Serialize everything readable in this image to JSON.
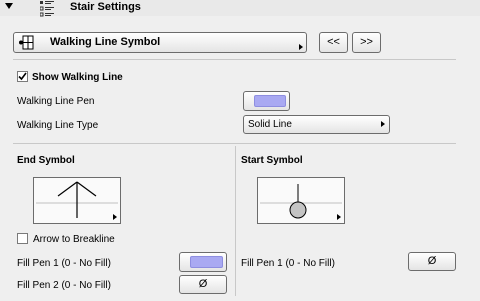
{
  "header": {
    "title": "Stair Settings"
  },
  "symbol_selector": {
    "value": "Walking Line Symbol",
    "prev_label": "<<",
    "next_label": ">>"
  },
  "show_walking_line": {
    "label": "Show Walking Line",
    "checked": true
  },
  "walking_line_pen": {
    "label": "Walking Line Pen",
    "color": "#a9a9f2"
  },
  "walking_line_type": {
    "label": "Walking Line Type",
    "value": "Solid Line"
  },
  "end_symbol": {
    "title": "End Symbol",
    "arrow_to_breakline": {
      "label": "Arrow to Breakline",
      "checked": false
    },
    "fill_pen_1": {
      "label": "Fill Pen 1 (0 - No Fill)",
      "color": "#a9a9f2"
    },
    "fill_pen_2": {
      "label": "Fill Pen 2 (0 - No Fill)",
      "value": "Ø"
    }
  },
  "start_symbol": {
    "title": "Start Symbol",
    "fill_pen_1": {
      "label": "Fill Pen 1 (0 - No Fill)",
      "value": "Ø"
    }
  }
}
